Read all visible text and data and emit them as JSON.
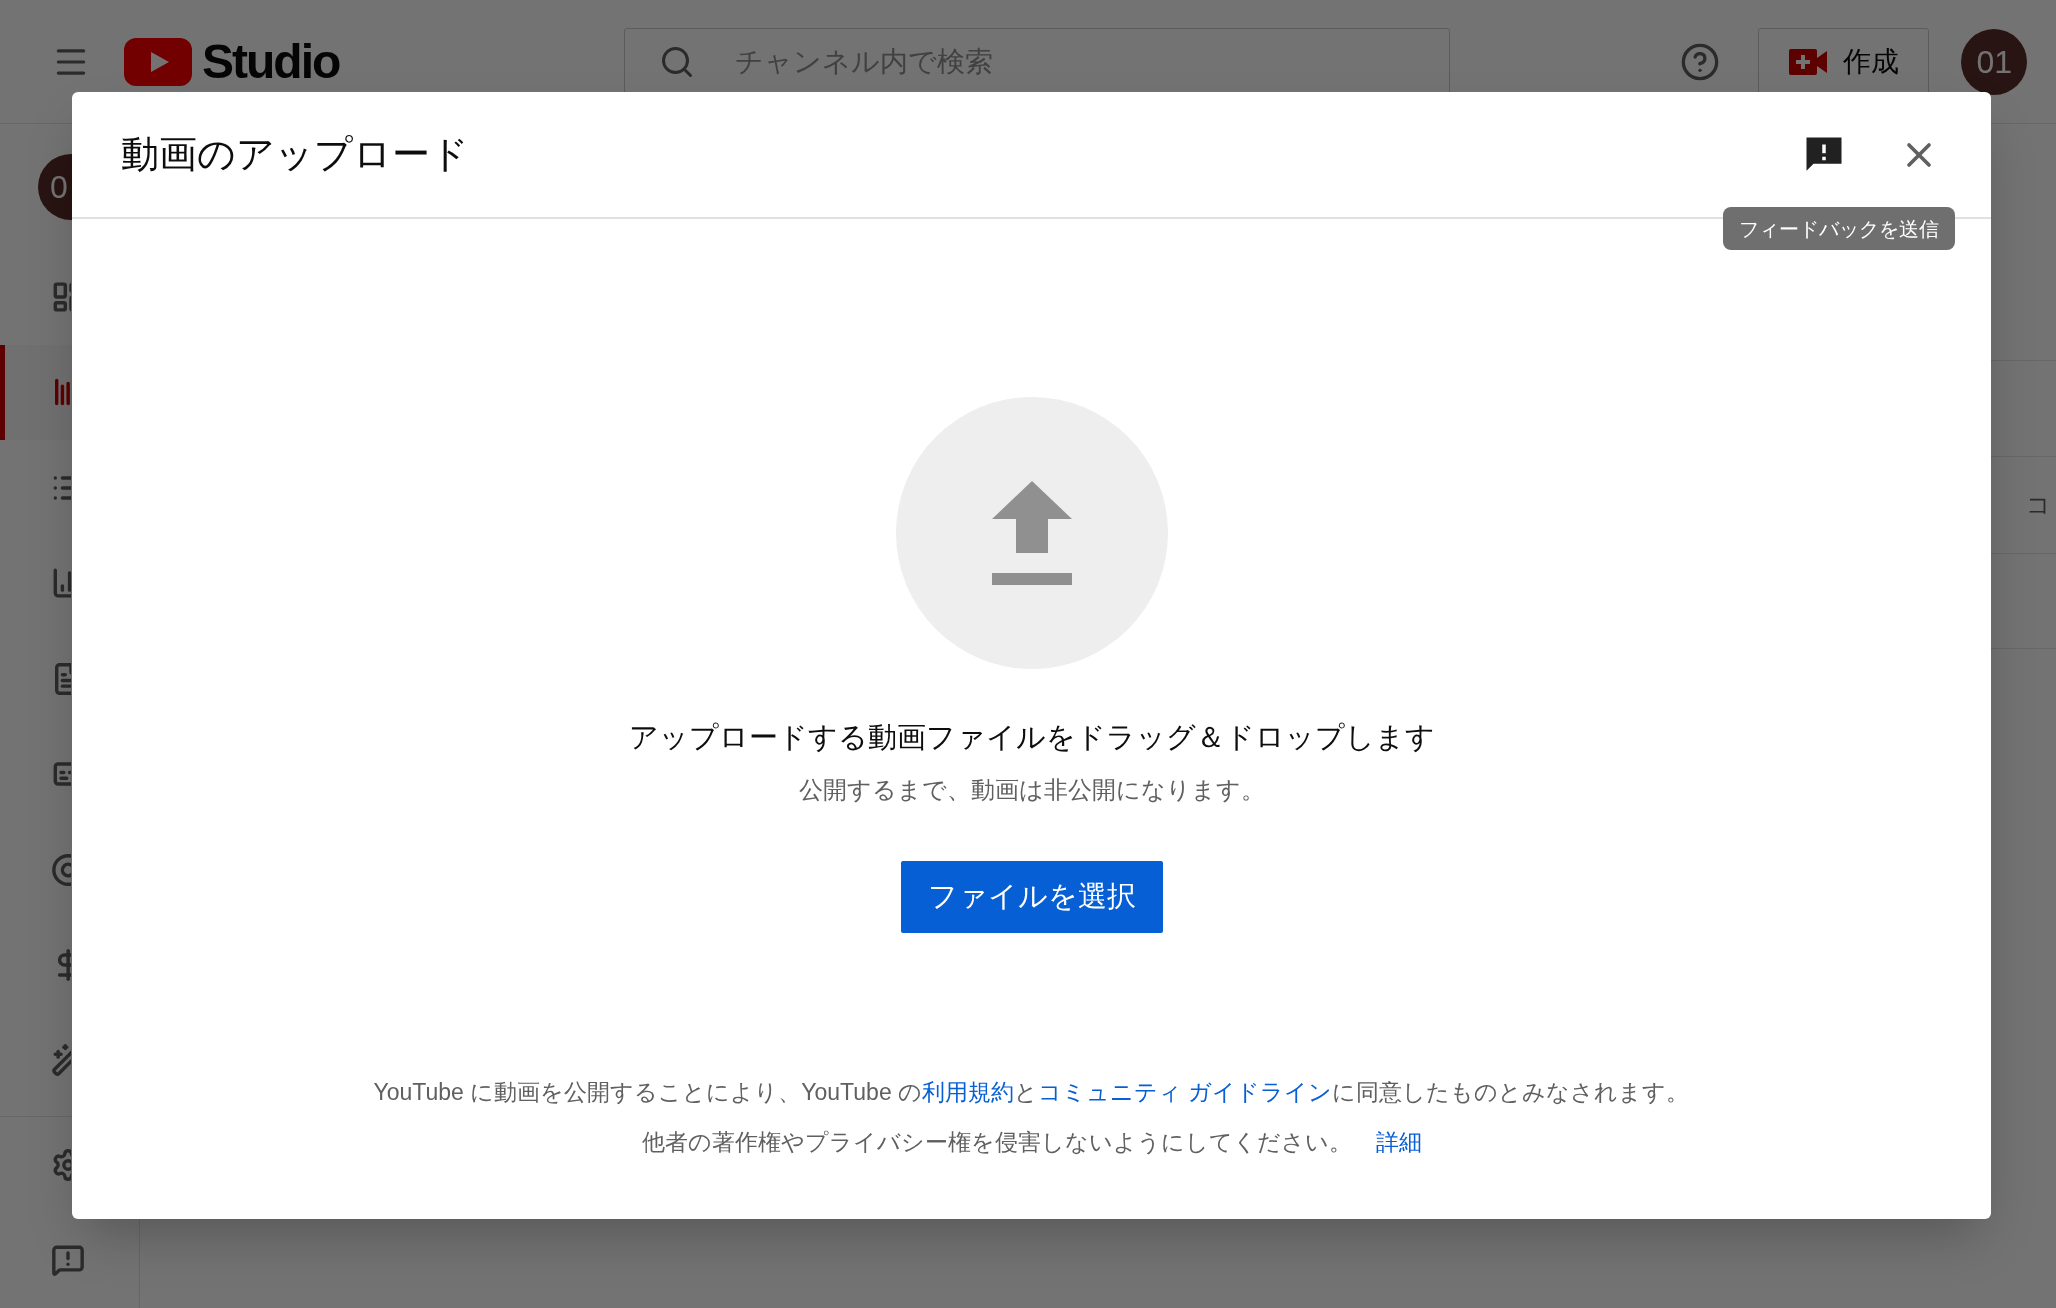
{
  "header": {
    "logo_text": "Studio",
    "search_placeholder": "チャンネル内で検索",
    "create_label": "作成",
    "avatar": "01"
  },
  "sidebar": {
    "avatar": "0",
    "items": [
      {
        "kind": "dashboard",
        "selected": false
      },
      {
        "kind": "content",
        "selected": true
      },
      {
        "kind": "playlists",
        "selected": false
      },
      {
        "kind": "analytics",
        "selected": false
      },
      {
        "kind": "comments",
        "selected": false
      },
      {
        "kind": "subtitles",
        "selected": false
      },
      {
        "kind": "copyright",
        "selected": false
      },
      {
        "kind": "monetization",
        "selected": false
      },
      {
        "kind": "customization",
        "selected": false
      }
    ],
    "bottom_items": [
      {
        "kind": "settings",
        "selected": false
      },
      {
        "kind": "feedback",
        "selected": false
      }
    ]
  },
  "content": {
    "cut_text": "コ"
  },
  "dialog": {
    "title": "動画のアップロード",
    "tooltip": "フィードバックを送信",
    "drop_text": "アップロードする動画ファイルをドラッグ＆ドロップします",
    "note": "公開するまで、動画は非公開になります。",
    "button": "ファイルを選択",
    "terms": [
      {
        "kind": "text",
        "text": "YouTube に動画を公開することにより、YouTube の"
      },
      {
        "kind": "link",
        "text": "利用規約"
      },
      {
        "kind": "text",
        "text": "と"
      },
      {
        "kind": "link",
        "text": "コミュニティ ガイドライン"
      },
      {
        "kind": "text",
        "text": "に同意したものとみなされます。"
      }
    ],
    "rights": "他者の著作権やプライバシー権を侵害しないようにしてください。",
    "details_link": "詳細"
  }
}
